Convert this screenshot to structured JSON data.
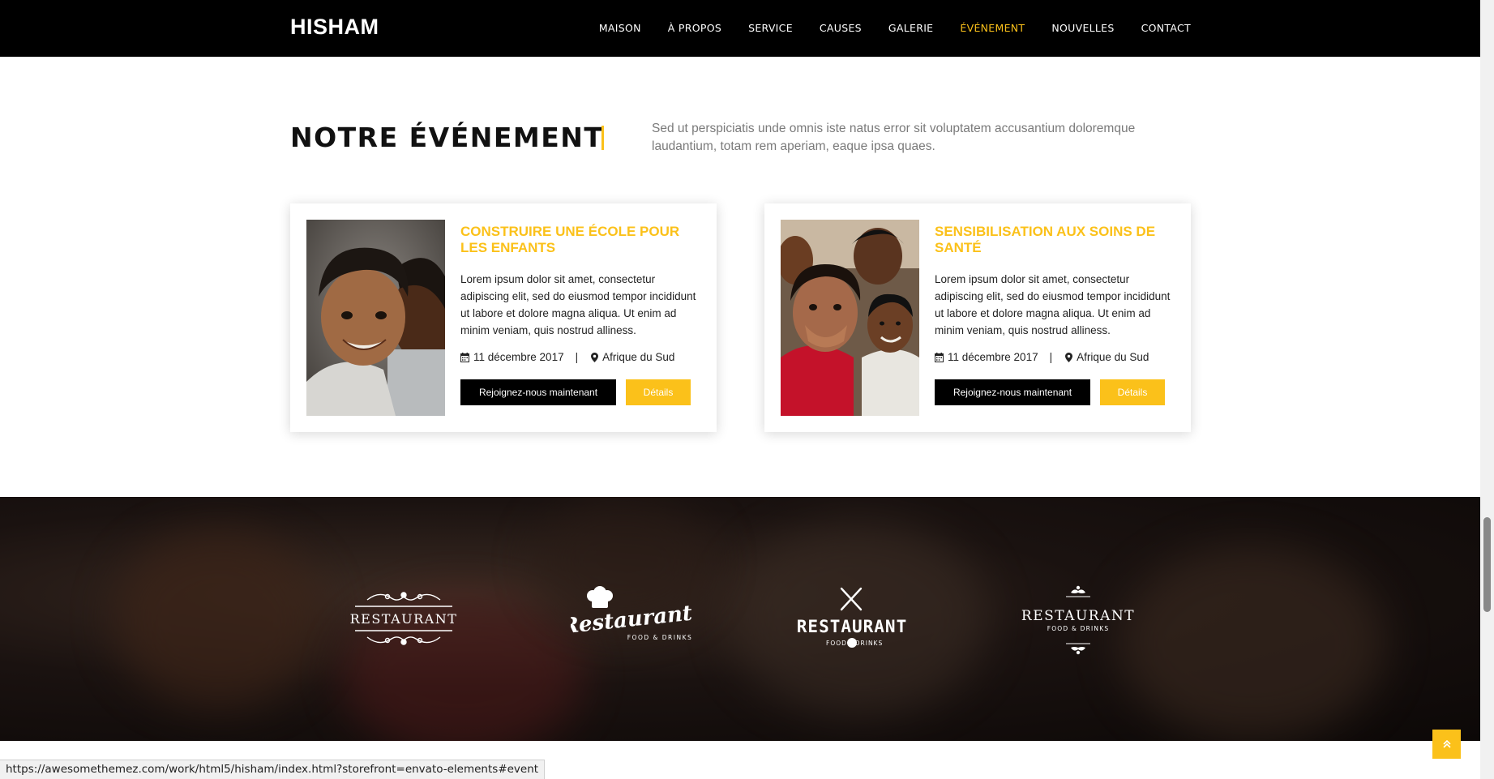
{
  "brand": "HISHAM",
  "nav": {
    "items": [
      {
        "label": "MAISON"
      },
      {
        "label": "À PROPOS"
      },
      {
        "label": "SERVICE"
      },
      {
        "label": "CAUSES"
      },
      {
        "label": "GALERIE"
      },
      {
        "label": "ÉVÉNEMENT"
      },
      {
        "label": "NOUVELLES"
      },
      {
        "label": "CONTACT"
      }
    ],
    "active": "ÉVÉNEMENT"
  },
  "section": {
    "title": "NOTRE ÉVÉNEMENT",
    "description": "Sed ut perspiciatis unde omnis iste natus error sit voluptatem accusantium doloremque laudantium, totam rem aperiam, eaque ipsa quaes."
  },
  "events": [
    {
      "title": "CONSTRUIRE UNE ÉCOLE POUR LES ENFANTS",
      "text": "Lorem ipsum dolor sit amet, consectetur adipiscing elit, sed do eiusmod tempor incididunt ut labore et dolore magna aliqua. Ut enim ad minim veniam, quis nostrud alliness.",
      "date": "11 décembre 2017",
      "separator": "|",
      "location": "Afrique du Sud",
      "join_label": "Rejoignez-nous maintenant",
      "details_label": "Détails"
    },
    {
      "title": "SENSIBILISATION AUX SOINS DE SANTÉ",
      "text": "Lorem ipsum dolor sit amet, consectetur adipiscing elit, sed do eiusmod tempor incididunt ut labore et dolore magna aliqua. Ut enim ad minim veniam, quis nostrud alliness.",
      "date": "11 décembre 2017",
      "separator": "|",
      "location": "Afrique du Sud",
      "join_label": "Rejoignez-nous maintenant",
      "details_label": "Détails"
    }
  ],
  "logos": [
    {
      "word": "RESTAURANT",
      "icon": "ornament-icon"
    },
    {
      "word": "Restaurant",
      "sub": "FOOD & DRINKS",
      "icon": "chef-hat-icon"
    },
    {
      "word": "RESTAURANT",
      "sub_left": "FOOD",
      "sub_right": "DRINKS",
      "icon": "fork-knife-icon"
    },
    {
      "word": "RESTAURANT",
      "sub": "FOOD & DRINKS",
      "icon": "flourish-icon"
    }
  ],
  "status_url": "https://awesomethemez.com/work/html5/hisham/index.html?storefront=envato-elements#event",
  "back_to_top_icon": "double-chevron-up-icon",
  "colors": {
    "accent": "#fbc11a",
    "nav_bg": "#000000",
    "title": "#111111",
    "desc": "#7a7a7a"
  }
}
